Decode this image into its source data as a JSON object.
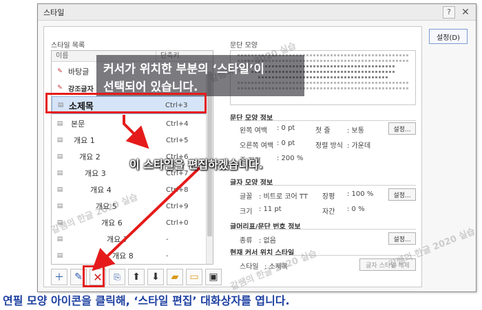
{
  "dialog": {
    "title": "스타일",
    "help": "?",
    "close": "✕"
  },
  "left": {
    "list_label": "스타일 목록",
    "col_name": "이름",
    "col_shortcut": "단축키",
    "items": [
      {
        "name": "바탕글",
        "shortcut": ""
      },
      {
        "name": "강조글자",
        "shortcut": ""
      },
      {
        "name": "소제목",
        "shortcut": "Ctrl+3"
      },
      {
        "name": "본문",
        "shortcut": "Ctrl+4"
      },
      {
        "name": "개요 1",
        "shortcut": "Ctrl+5"
      },
      {
        "name": "개요 2",
        "shortcut": "Ctrl+6"
      },
      {
        "name": "개요 3",
        "shortcut": "Ctrl+7"
      },
      {
        "name": "개요 4",
        "shortcut": "Ctrl+8"
      },
      {
        "name": "개요 5",
        "shortcut": "Ctrl+9"
      },
      {
        "name": "개요 6",
        "shortcut": "Ctrl+0"
      },
      {
        "name": "개요 7",
        "shortcut": "-"
      },
      {
        "name": "개요 8",
        "shortcut": "-"
      }
    ]
  },
  "right": {
    "preview_label": "문단 모양",
    "para_title": "문단 모양 정보",
    "left_margin_label": "왼쪽 여백",
    "left_margin_value": ": 0 pt",
    "first_line_label": "첫 줄",
    "first_line_value": ": 보통",
    "right_margin_label": "오른쪽 여백",
    "right_margin_value": ": 0 pt",
    "align_label": "정렬 방식",
    "align_value": ": 가운데",
    "line_spacing_label": "줄 간격",
    "line_spacing_value": ": 200 %",
    "char_title": "글자 모양 정보",
    "font_label": "글꼴",
    "font_value": ": 비트로 코어 TT",
    "ratio_label": "장평",
    "ratio_value": ": 100 %",
    "size_label": "크기",
    "size_value": ": 11 pt",
    "spacing_label": "자간",
    "spacing_value": ": 0 %",
    "numbering_title": "글머리표/문단 번호 정보",
    "kind_label": "종류",
    "kind_value": ": 없음",
    "current_title": "현재 커서 위치 스타일",
    "style_label": "스타일",
    "style_value": ": 소제목",
    "setting_btn": "설정...",
    "char_style_release": "글자 스타일 해제"
  },
  "settings_button": "설정(D)",
  "overlay": {
    "banner_line1": "커서가 위치한 부분의 ‘스타일’이",
    "banner_line2": "선택되어 있습니다.",
    "callout": "이 스타일을 편집하겠습니다.",
    "bottom_note": "연필 모양 아이콘을 클릭해, ‘스타일 편집’ 대화상자를 엽니다.",
    "watermark": "갈쌤의 한글 2020 실습"
  },
  "colors": {
    "accent_red": "#e51b1b",
    "note_blue": "#1c3fa0"
  },
  "icons": [
    "add-icon",
    "pencil-icon",
    "delete-icon",
    "copy-style-icon",
    "arrow-up-icon",
    "arrow-down-icon",
    "folder-open-icon",
    "folder-icon",
    "save-icon"
  ]
}
